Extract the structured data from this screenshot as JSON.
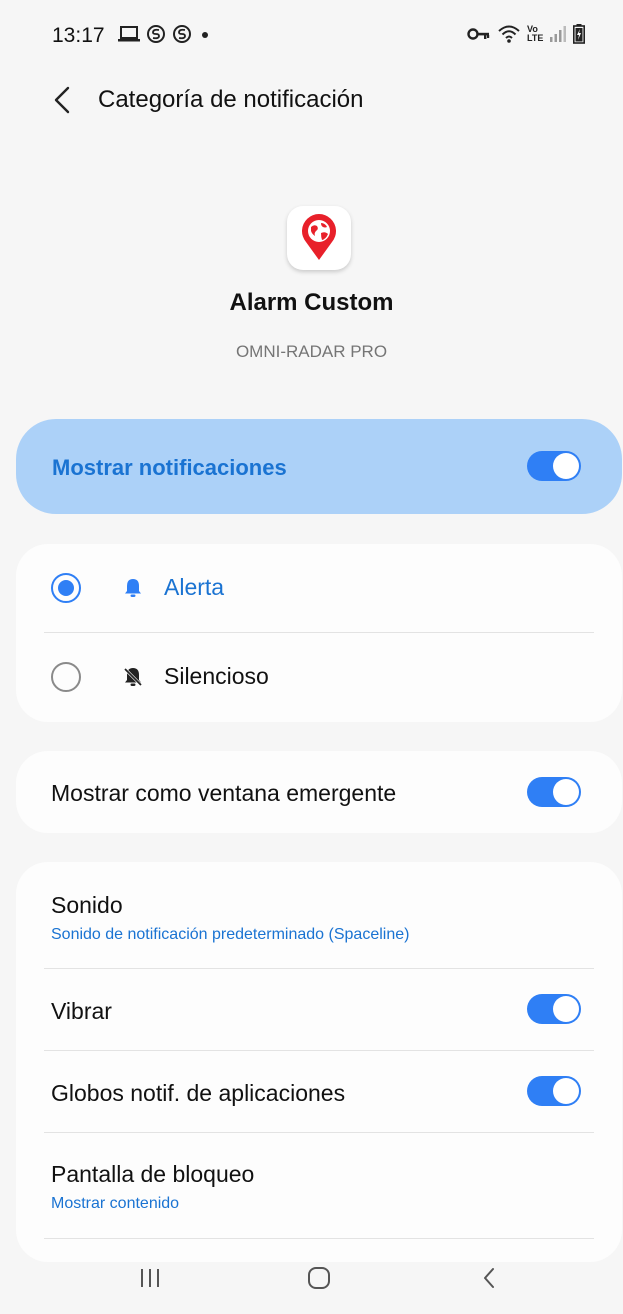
{
  "status_bar": {
    "time": "13:17",
    "left_icons": [
      "laptop-icon",
      "s-app-icon",
      "s-app-icon",
      "dot-icon"
    ],
    "right_icons": [
      "key-icon",
      "wifi-icon",
      "volte-icon",
      "signal-icon",
      "battery-icon"
    ],
    "volte_text": "Vo LTE"
  },
  "header": {
    "title": "Categoría de notificación"
  },
  "app": {
    "name": "Alarm Custom",
    "subtitle": "OMNI-RADAR PRO",
    "icon": "map-pin-globe-icon"
  },
  "master_switch": {
    "label": "Mostrar notificaciones",
    "on": true
  },
  "mode": {
    "options": [
      {
        "label": "Alerta",
        "icon": "bell-icon",
        "selected": true
      },
      {
        "label": "Silencioso",
        "icon": "bell-off-icon",
        "selected": false
      }
    ]
  },
  "popup": {
    "label": "Mostrar como ventana emergente",
    "on": true
  },
  "settings": {
    "sound": {
      "label": "Sonido",
      "value": "Sonido de notificación predeterminado (Spaceline)"
    },
    "vibrate": {
      "label": "Vibrar",
      "on": true
    },
    "badges": {
      "label": "Globos notif. de aplicaciones",
      "on": true
    },
    "lock_screen": {
      "label": "Pantalla de bloqueo",
      "value": "Mostrar contenido"
    }
  },
  "colors": {
    "accent": "#2f7ff5",
    "master_bg": "#acd1f8",
    "link": "#1a73d2",
    "background": "#f6f6f6"
  },
  "nav_bar": {
    "buttons": [
      "recents-icon",
      "home-icon",
      "back-icon"
    ]
  }
}
